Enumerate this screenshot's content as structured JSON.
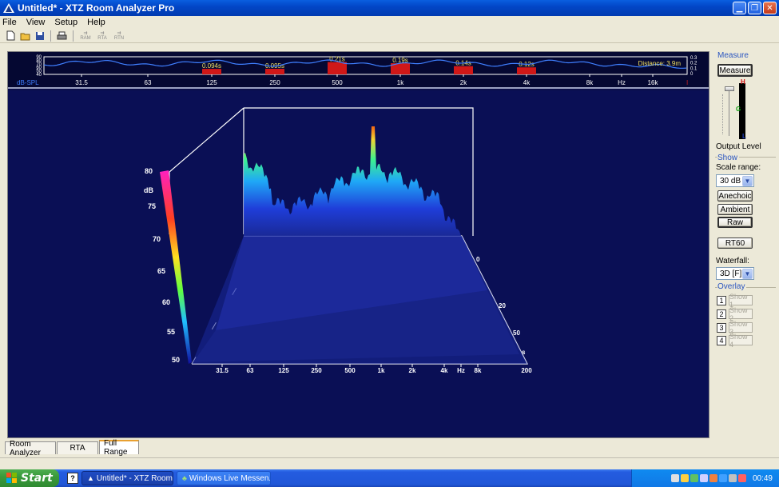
{
  "window": {
    "title": "Untitled* - XTZ Room Analyzer Pro"
  },
  "menu": [
    "File",
    "View",
    "Setup",
    "Help"
  ],
  "toolbar": {
    "disabled": [
      "RAM",
      "RTA",
      "RTN"
    ]
  },
  "strip": {
    "yticks": [
      "90",
      "80",
      "70",
      "60",
      "50",
      "40"
    ],
    "rticks": [
      "0.3",
      "0.2",
      "0.1",
      "0"
    ],
    "xaxis_label": "dB-SPL",
    "freq_ticks": [
      "31.5",
      "63",
      "125",
      "250",
      "500",
      "1k",
      "2k",
      "4k",
      "8k",
      "Hz",
      "16k"
    ],
    "distance": "Distance: 3.9m",
    "marker": "I",
    "rt60": [
      {
        "label": "0.094s",
        "value": 0.094
      },
      {
        "label": "0.095s",
        "value": 0.095
      },
      {
        "label": "0.21s",
        "value": 0.21
      },
      {
        "label": "0.19s",
        "value": 0.19
      },
      {
        "label": "0.14s",
        "value": 0.14
      },
      {
        "label": "0.12s",
        "value": 0.12
      }
    ]
  },
  "waterfall": {
    "zticks": [
      "80",
      "dB",
      "75",
      "70",
      "65",
      "60",
      "55",
      "50"
    ],
    "xticks": [
      "31.5",
      "63",
      "125",
      "250",
      "500",
      "1k",
      "2k",
      "4k",
      "Hz",
      "8k"
    ],
    "depth_ticks": [
      "0",
      "20",
      "50",
      "s",
      "200"
    ]
  },
  "panel": {
    "measure_label": "Measure",
    "measure_button": "Measure",
    "level_marks": {
      "top": "H",
      "mid": "G",
      "bottom": "L"
    },
    "output_level": "Output Level",
    "show_label": "Show",
    "scale_range_label": "Scale range:",
    "scale_range_value": "30 dB",
    "anechoic": "Anechoic",
    "ambient": "Ambient",
    "raw": "Raw",
    "rt60": "RT60",
    "waterfall_label": "Waterfall:",
    "waterfall_value": "3D [F]",
    "overlay_label": "Overlay",
    "overlays": [
      {
        "num": "1",
        "label": "Show 1"
      },
      {
        "num": "2",
        "label": "Show 2"
      },
      {
        "num": "3",
        "label": "Show 3"
      },
      {
        "num": "4",
        "label": "Show 4"
      }
    ]
  },
  "tabs": [
    "Room Analyzer",
    "RTA",
    "Full Range"
  ],
  "taskbar": {
    "start": "Start",
    "tasks": [
      "Untitled* - XTZ Room ...",
      "Windows Live Messen..."
    ],
    "clock": "00:49"
  },
  "colors": {
    "plot_bg": "#0a0f55",
    "strip_bg": "#050832",
    "curve": "#3f7fff",
    "rt_bar": "#d01818",
    "label_yellow": "#f0e060"
  }
}
